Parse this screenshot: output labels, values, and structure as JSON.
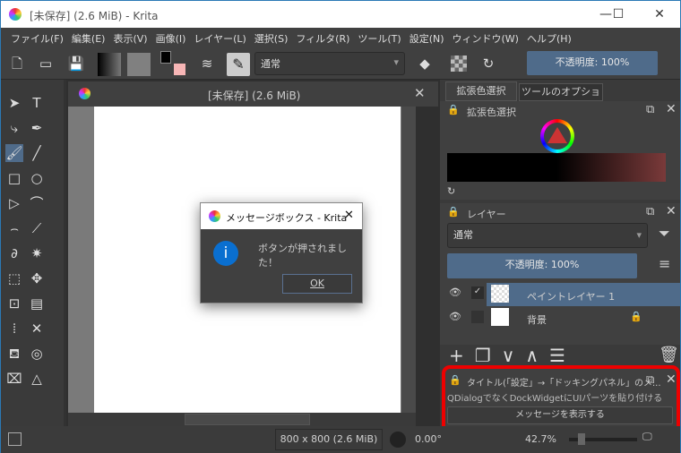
{
  "window": {
    "title": "[未保存]  (2.6 MiB)  - Krita",
    "minimize": "—",
    "maximize": "☐",
    "close": "✕"
  },
  "menu": [
    "ファイル(F)",
    "編集(E)",
    "表示(V)",
    "画像(I)",
    "レイヤー(L)",
    "選択(S)",
    "フィルタ(R)",
    "ツール(T)",
    "設定(N)",
    "ウィンドウ(W)",
    "ヘルプ(H)"
  ],
  "toolbar": {
    "blend_mode": "通常",
    "opacity": "不透明度: 100%",
    "fg_color": "#000000",
    "bg_color": "#f7b6b6"
  },
  "tools": [
    "select-icon",
    "text-icon",
    "edit-shapes-icon",
    "calligraphy-icon",
    "brush-icon",
    "line-icon",
    "rectangle-icon",
    "ellipse-icon",
    "polygon-icon",
    "polyline-icon",
    "bezier-icon",
    "freehand-path-icon",
    "dynamic-brush-icon",
    "multibrush-icon",
    "transform-icon",
    "move-icon",
    "crop-icon",
    "gradient-icon",
    "color-picker-icon",
    "smart-patch-icon",
    "fill-icon",
    "enclosed-fill-icon",
    "assistant-icon",
    "measure-icon"
  ],
  "document": {
    "title": "[未保存]  (2.6 MiB)"
  },
  "dock": {
    "tabs": [
      "拡張色選択",
      "ツールのオプション"
    ],
    "color_selector_title": "拡張色選択",
    "layers_title": "レイヤー",
    "layer_blend": "通常",
    "layer_opacity": "不透明度: 100%",
    "layers": [
      {
        "name": "ペイントレイヤー 1",
        "selected": true
      },
      {
        "name": "背景",
        "selected": false
      }
    ],
    "custom_title": "タイトル(「設定」→「ドッキングパネル」のメ...",
    "custom_desc": "QDialogでなくDockWidgetにUIパーツを貼り付ける",
    "custom_button": "メッセージを表示する"
  },
  "status": {
    "size": "800 x 800 (2.6 MiB)",
    "rotation": "0.00°",
    "zoom": "42.7%"
  },
  "dialog": {
    "title": "メッセージボックス - Krita",
    "message": "ボタンが押されました！",
    "ok": "OK",
    "close": "✕"
  },
  "colors": {
    "accent": "#4f6b8a",
    "highlight": "#e00000"
  }
}
